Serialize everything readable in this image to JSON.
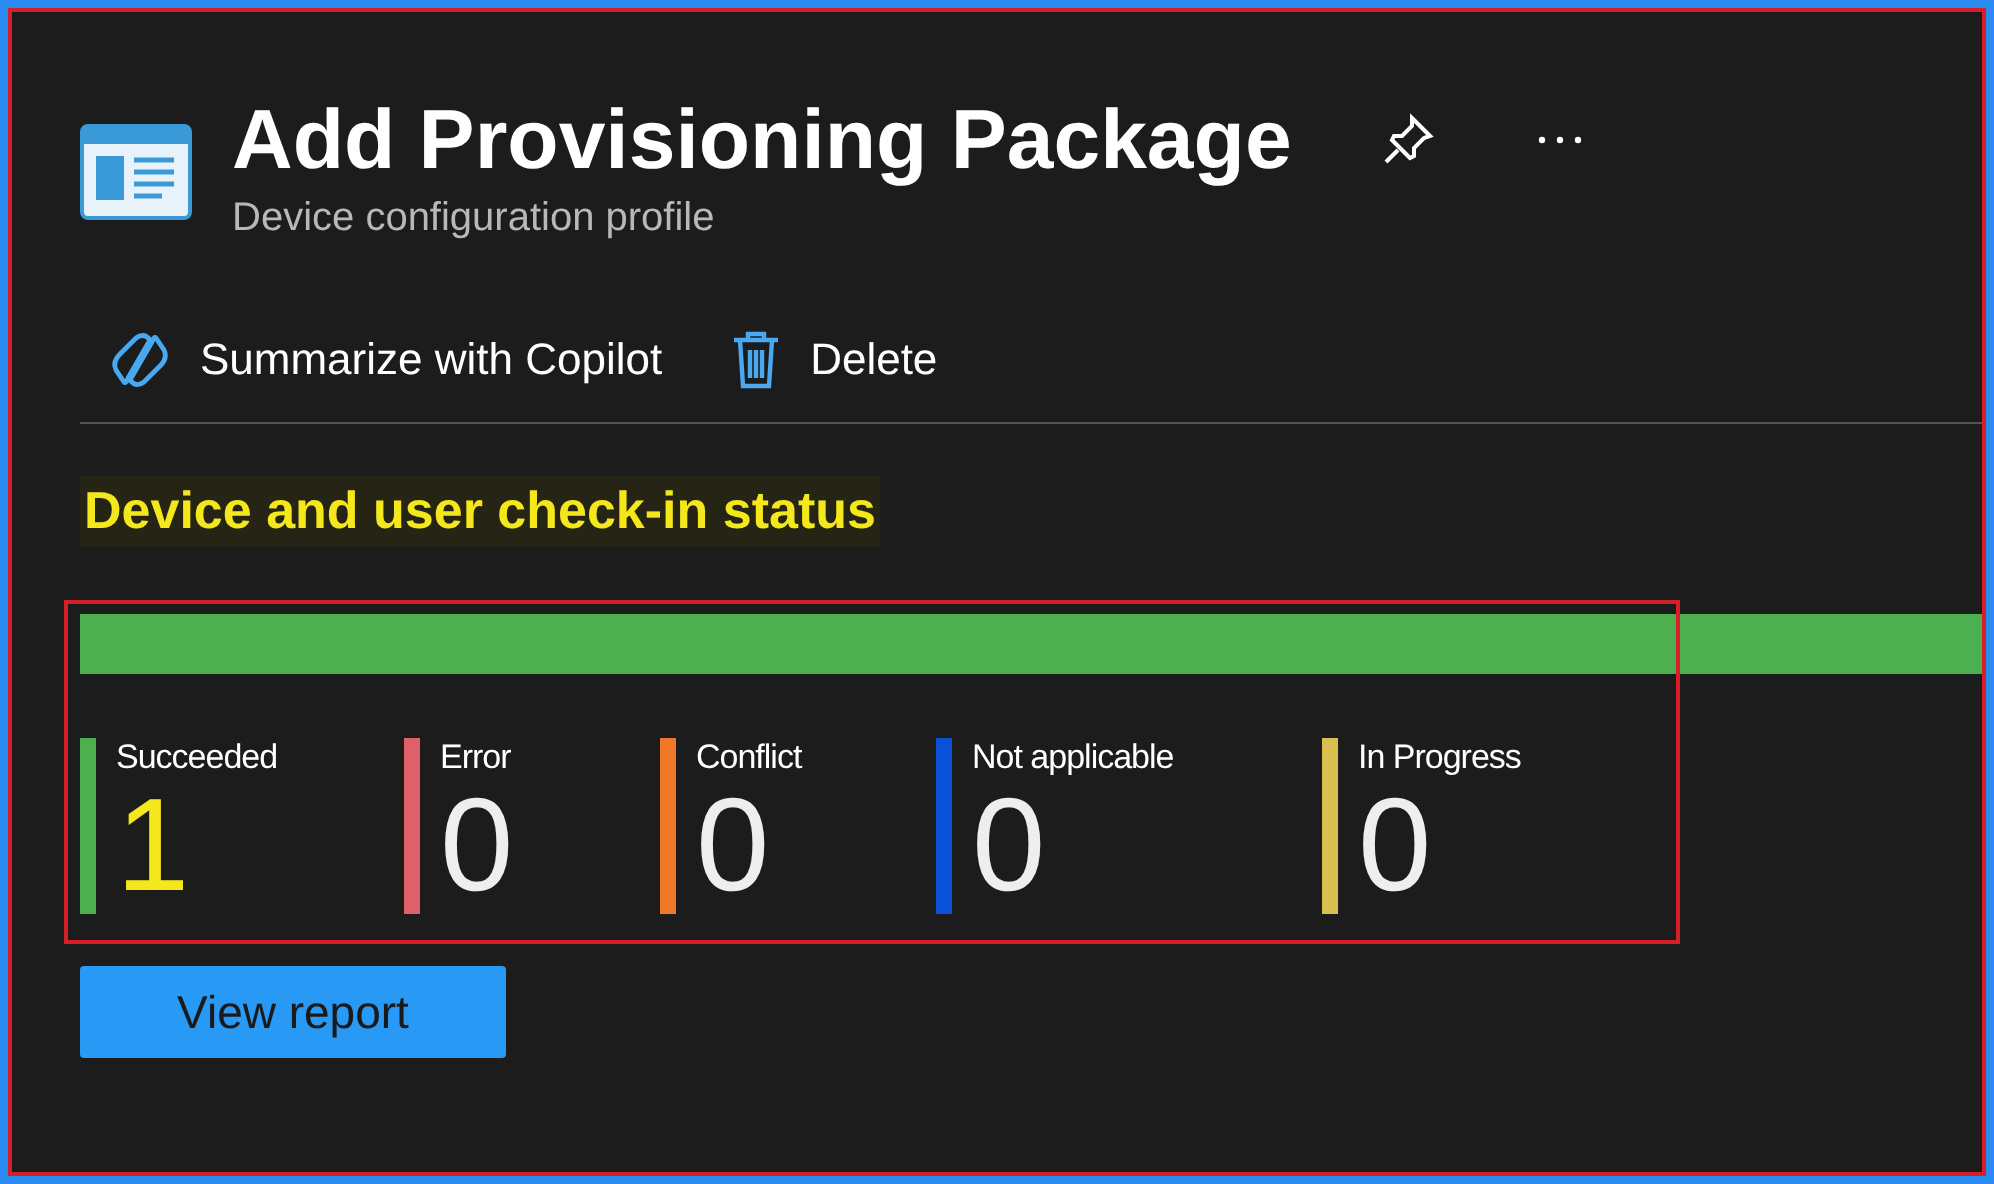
{
  "header": {
    "title": "Add Provisioning Package",
    "subtitle": "Device configuration profile"
  },
  "toolbar": [
    {
      "kind": "copilot",
      "label": "Summarize with Copilot"
    },
    {
      "kind": "delete",
      "label": "Delete"
    }
  ],
  "section": {
    "title": "Device and user check-in status"
  },
  "progress": {
    "level": 1
  },
  "statuses": [
    {
      "label": "Succeeded",
      "count": "1",
      "color": "#4caf50"
    },
    {
      "label": "Error",
      "count": "0",
      "color": "#e0606a"
    },
    {
      "label": "Conflict",
      "count": "0",
      "color": "#f07828"
    },
    {
      "label": "Not applicable",
      "count": "0",
      "color": "#0a50d8"
    },
    {
      "label": "In Progress",
      "count": "0",
      "color": "#d8c050"
    }
  ],
  "view_button": {
    "label": "View report"
  }
}
